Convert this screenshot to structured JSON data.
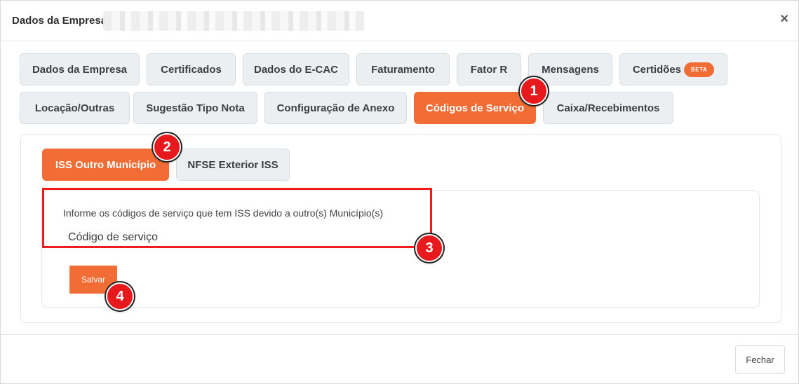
{
  "header": {
    "title": "Dados da Empresa",
    "close_symbol": "×"
  },
  "tabs": [
    {
      "label": "Dados da Empresa"
    },
    {
      "label": "Certificados"
    },
    {
      "label": "Dados do E-CAC"
    },
    {
      "label": "Faturamento"
    },
    {
      "label": "Fator R"
    },
    {
      "label": "Mensagens"
    },
    {
      "label": "Certidões",
      "badge": "BETA"
    },
    {
      "label": "Locação/Outras"
    },
    {
      "label": "Sugestão Tipo Nota"
    },
    {
      "label": "Configuração de Anexo"
    },
    {
      "label": "Códigos de Serviço",
      "active": true
    },
    {
      "label": "Caixa/Recebimentos"
    }
  ],
  "subtabs": [
    {
      "label": "ISS Outro Município",
      "active": true
    },
    {
      "label": "NFSE Exterior ISS"
    }
  ],
  "content": {
    "instruction": "Informe os códigos de serviço que tem ISS devido a outro(s) Município(s)",
    "code_label": "Código de serviço",
    "save_label": "Salvar"
  },
  "footer": {
    "close_label": "Fechar"
  },
  "markers": [
    "1",
    "2",
    "3",
    "4"
  ],
  "colors": {
    "accent": "#f26c36",
    "highlight": "#ee1c1c",
    "marker": "#e8191d"
  }
}
